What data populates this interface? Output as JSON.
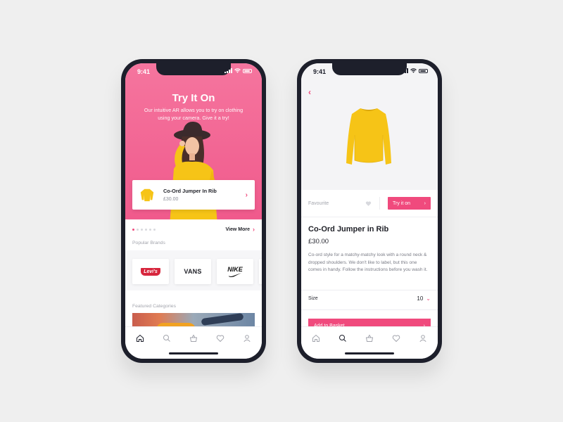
{
  "left_screen": {
    "status_time": "9:41",
    "hero": {
      "title": "Try It On",
      "description": "Our intuitive AR allows you to try on clothing using your camera. Give it a try!",
      "gradient_colors": [
        "#f5759e",
        "#f05a8c"
      ]
    },
    "featured_product": {
      "name": "Co-Ord Jumper In Rib",
      "price": "£30.00",
      "icon": "chevron-right-icon"
    },
    "carousel": {
      "total_dots": 6,
      "active_index": 0
    },
    "view_more_label": "View More",
    "popular_brands_label": "Popular Brands",
    "brands": [
      {
        "name": "Levi's",
        "label": "Levi's"
      },
      {
        "name": "Vans",
        "label": "VANS"
      },
      {
        "name": "Nike",
        "label": "NIKE"
      }
    ],
    "featured_categories_label": "Featured Categories",
    "tabbar": {
      "items": [
        "home-icon",
        "search-icon",
        "basket-icon",
        "heart-icon",
        "profile-icon"
      ],
      "active": "home-icon"
    }
  },
  "right_screen": {
    "status_time": "9:41",
    "back_icon": "chevron-left-icon",
    "favourite_label": "Favourite",
    "try_on_label": "Try it on",
    "product": {
      "title": "Co-Ord Jumper in Rib",
      "price": "£30.00",
      "description": "Co-ord style for a matchy-matchy look with a round neck & dropped shoulders. We don't like to label, but this one comes in handy. Follow the instructions before you wash it."
    },
    "size": {
      "label": "Size",
      "value": "10"
    },
    "add_to_basket_label": "Add to Basket",
    "tabbar": {
      "items": [
        "home-icon",
        "search-icon",
        "basket-icon",
        "heart-icon",
        "profile-icon"
      ],
      "active": "search-icon"
    }
  },
  "colors": {
    "accent": "#f04a7d",
    "frame": "#1d1f2b",
    "background": "#efefef",
    "sweater": "#f6c417"
  }
}
